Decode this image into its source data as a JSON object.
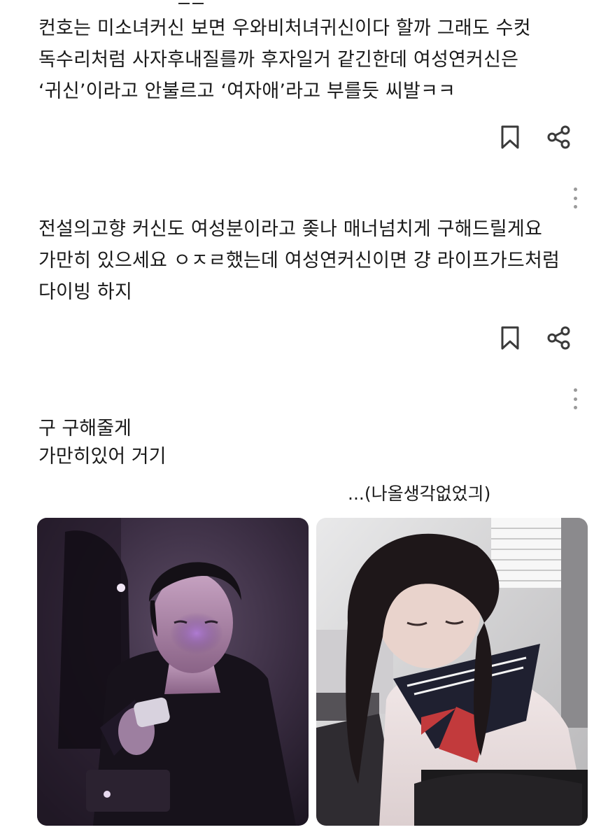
{
  "posts": [
    {
      "lines": [
        "컨호는 미소녀커신 보면 우와비처녀귀신이다 할까 그래도 수컷",
        "독수리처럼 사자후내질를까 후자일거 같긴한데 여성연커신은",
        "‘귀신’이라고 안불르고 ‘여자애’라고 부를듯  씨발ㅋㅋ"
      ],
      "bookmark_icon": "bookmark-icon",
      "share_icon": "share-icon",
      "more_icon": "more-vertical-icon"
    },
    {
      "lines": [
        "전설의고향 커신도 여성분이라고  좆나 매너넘치게 구해드릴게요",
        "가만히 있으세요 ㅇㅈㄹ했는데 여성연커신이면 걍 라이프가드처럼",
        "다이빙 하지"
      ],
      "bookmark_icon": "bookmark-icon",
      "share_icon": "share-icon",
      "more_icon": "more-vertical-icon"
    }
  ],
  "meme": {
    "left_caption_lines": [
      "구 구해줄게",
      "가만히있어  거기"
    ],
    "right_caption": "...(나올생각없었긔)",
    "left_photo": "photo-man-with-phone-purple-light",
    "right_photo": "photo-girl-in-sailor-uniform"
  },
  "colors": {
    "text": "#1a1a1a",
    "icon": "#3a3a3a",
    "kebab": "#9a9a9a",
    "background": "#ffffff"
  }
}
